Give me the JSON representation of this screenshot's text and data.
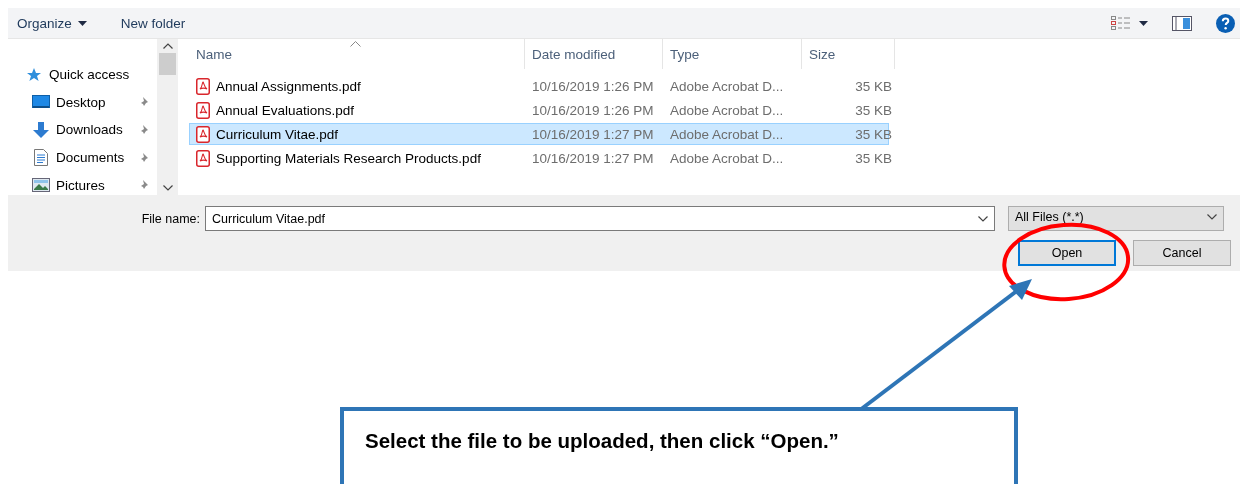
{
  "toolbar": {
    "organize": "Organize",
    "new_folder": "New folder"
  },
  "navigation": [
    {
      "label": "Quick access",
      "kind": "star",
      "pinned": false
    },
    {
      "label": "Desktop",
      "kind": "desktop",
      "pinned": true
    },
    {
      "label": "Downloads",
      "kind": "downloads",
      "pinned": true
    },
    {
      "label": "Documents",
      "kind": "documents",
      "pinned": true
    },
    {
      "label": "Pictures",
      "kind": "pictures",
      "pinned": true
    }
  ],
  "columns": [
    "Name",
    "Date modified",
    "Type",
    "Size"
  ],
  "rows": [
    {
      "name": "Annual Assignments.pdf",
      "date": "10/16/2019 1:26 PM",
      "type": "Adobe Acrobat D...",
      "size": "35 KB",
      "selected": false
    },
    {
      "name": "Annual Evaluations.pdf",
      "date": "10/16/2019 1:26 PM",
      "type": "Adobe Acrobat D...",
      "size": "35 KB",
      "selected": false
    },
    {
      "name": "Curriculum Vitae.pdf",
      "date": "10/16/2019 1:27 PM",
      "type": "Adobe Acrobat D...",
      "size": "35 KB",
      "selected": true
    },
    {
      "name": "Supporting Materials Research Products.pdf",
      "date": "10/16/2019 1:27 PM",
      "type": "Adobe Acrobat D...",
      "size": "35 KB",
      "selected": false
    }
  ],
  "footer": {
    "file_name_label": "File name:",
    "file_name": "Curriculum Vitae.pdf",
    "filter": "All Files (*.*)",
    "buttons": [
      {
        "label": "Open",
        "default": true
      },
      {
        "label": "Cancel",
        "default": false
      }
    ]
  },
  "annotation": {
    "text": "Select the file to be uploaded, then click “Open.”"
  }
}
